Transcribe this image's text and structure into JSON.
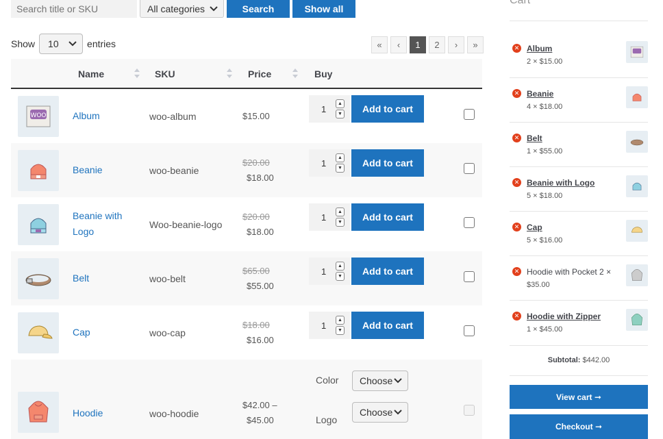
{
  "toolbar": {
    "search_placeholder": "Search title or SKU",
    "category_selected": "All categories",
    "search_label": "Search",
    "show_all_label": "Show all"
  },
  "entries": {
    "show_label": "Show",
    "value": "10",
    "entries_label": "entries"
  },
  "pagination": {
    "first": "«",
    "prev": "‹",
    "pages": [
      "1",
      "2"
    ],
    "current": "1",
    "next": "›",
    "last": "»"
  },
  "table": {
    "headers": {
      "name": "Name",
      "sku": "SKU",
      "price": "Price",
      "buy": "Buy"
    },
    "add_to_cart_label": "Add to cart",
    "rows": [
      {
        "name": "Album",
        "sku": "woo-album",
        "price": "$15.00",
        "old_price": "",
        "qty": "1"
      },
      {
        "name": "Beanie",
        "sku": "woo-beanie",
        "price": "$18.00",
        "old_price": "$20.00",
        "qty": "1"
      },
      {
        "name_line1": "Beanie with",
        "name_line2": "Logo",
        "sku": "Woo-beanie-logo",
        "price": "$18.00",
        "old_price": "$20.00",
        "qty": "1"
      },
      {
        "name": "Belt",
        "sku": "woo-belt",
        "price": "$55.00",
        "old_price": "$65.00",
        "qty": "1"
      },
      {
        "name": "Cap",
        "sku": "woo-cap",
        "price": "$16.00",
        "old_price": "$18.00",
        "qty": "1"
      }
    ],
    "hoodie": {
      "name": "Hoodie",
      "sku": "woo-hoodie",
      "price_line1": "$42.00 –",
      "price_line2": "$45.00",
      "color_label": "Color",
      "logo_label": "Logo",
      "choose": "Choose"
    }
  },
  "cart": {
    "title": "Cart",
    "items": [
      {
        "name": "Album",
        "qty": "2 × $15.00"
      },
      {
        "name": "Beanie",
        "qty": "4 × $18.00"
      },
      {
        "name": "Belt",
        "qty": "1 × $55.00"
      },
      {
        "name": "Beanie with Logo",
        "qty": "5 × $18.00"
      },
      {
        "name": "Cap",
        "qty": "5 × $16.00"
      },
      {
        "name": "Hoodie with Pocket 2 ×",
        "qty": "$35.00"
      },
      {
        "name": "Hoodie with Zipper",
        "qty": "1 × $45.00"
      }
    ],
    "subtotal_label": "Subtotal:",
    "subtotal_value": "$442.00",
    "view_cart_label": "View cart",
    "checkout_label": "Checkout",
    "arrow": "➞"
  }
}
